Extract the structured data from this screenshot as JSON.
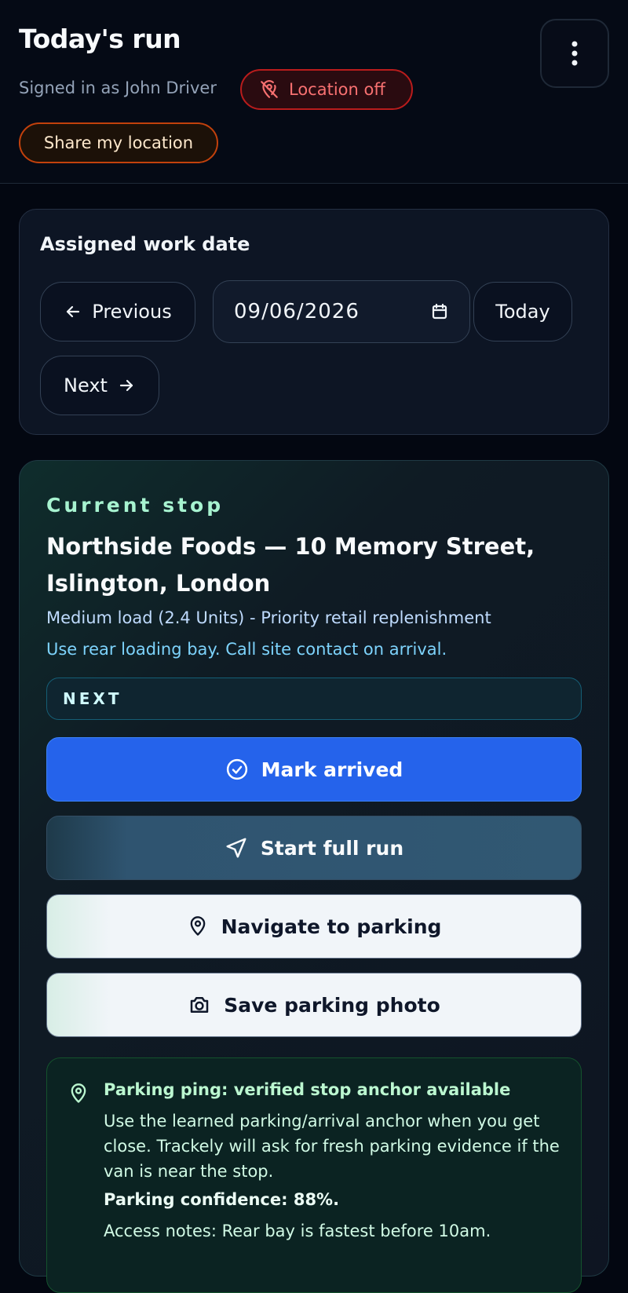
{
  "header": {
    "title": "Today's run",
    "signed_in": "Signed in as John Driver",
    "location_status": "Location off",
    "share_label": "Share my location",
    "menu_icon": "more-vertical-icon"
  },
  "date_card": {
    "label": "Assigned work date",
    "previous_label": "Previous",
    "date_value": "09/06/2026",
    "today_label": "Today",
    "next_label": "Next"
  },
  "stop_card": {
    "eyebrow": "Current stop",
    "title": "Northside Foods — 10 Memory Street, Islington, London",
    "load": "Medium load (2.4 Units) - Priority retail replenishment",
    "notes": "Use rear loading bay. Call site contact on arrival.",
    "status": "NEXT",
    "actions": {
      "arrived": "Mark arrived",
      "run": "Start full run",
      "navigate": "Navigate to parking",
      "photo": "Save parking photo"
    },
    "ping": {
      "title": "Parking ping: verified stop anchor available",
      "body": "Use the learned parking/arrival anchor when you get close. Trackely will ask for fresh parking evidence if the van is near the stop.",
      "confidence": "Parking confidence: 88%.",
      "access": "Access notes: Rear bay is fastest before 10am."
    }
  },
  "colors": {
    "accent_blue": "#2563eb",
    "alert_red": "#f87171",
    "share_orange": "#c2410c",
    "teal_label": "#a7f3d0"
  }
}
